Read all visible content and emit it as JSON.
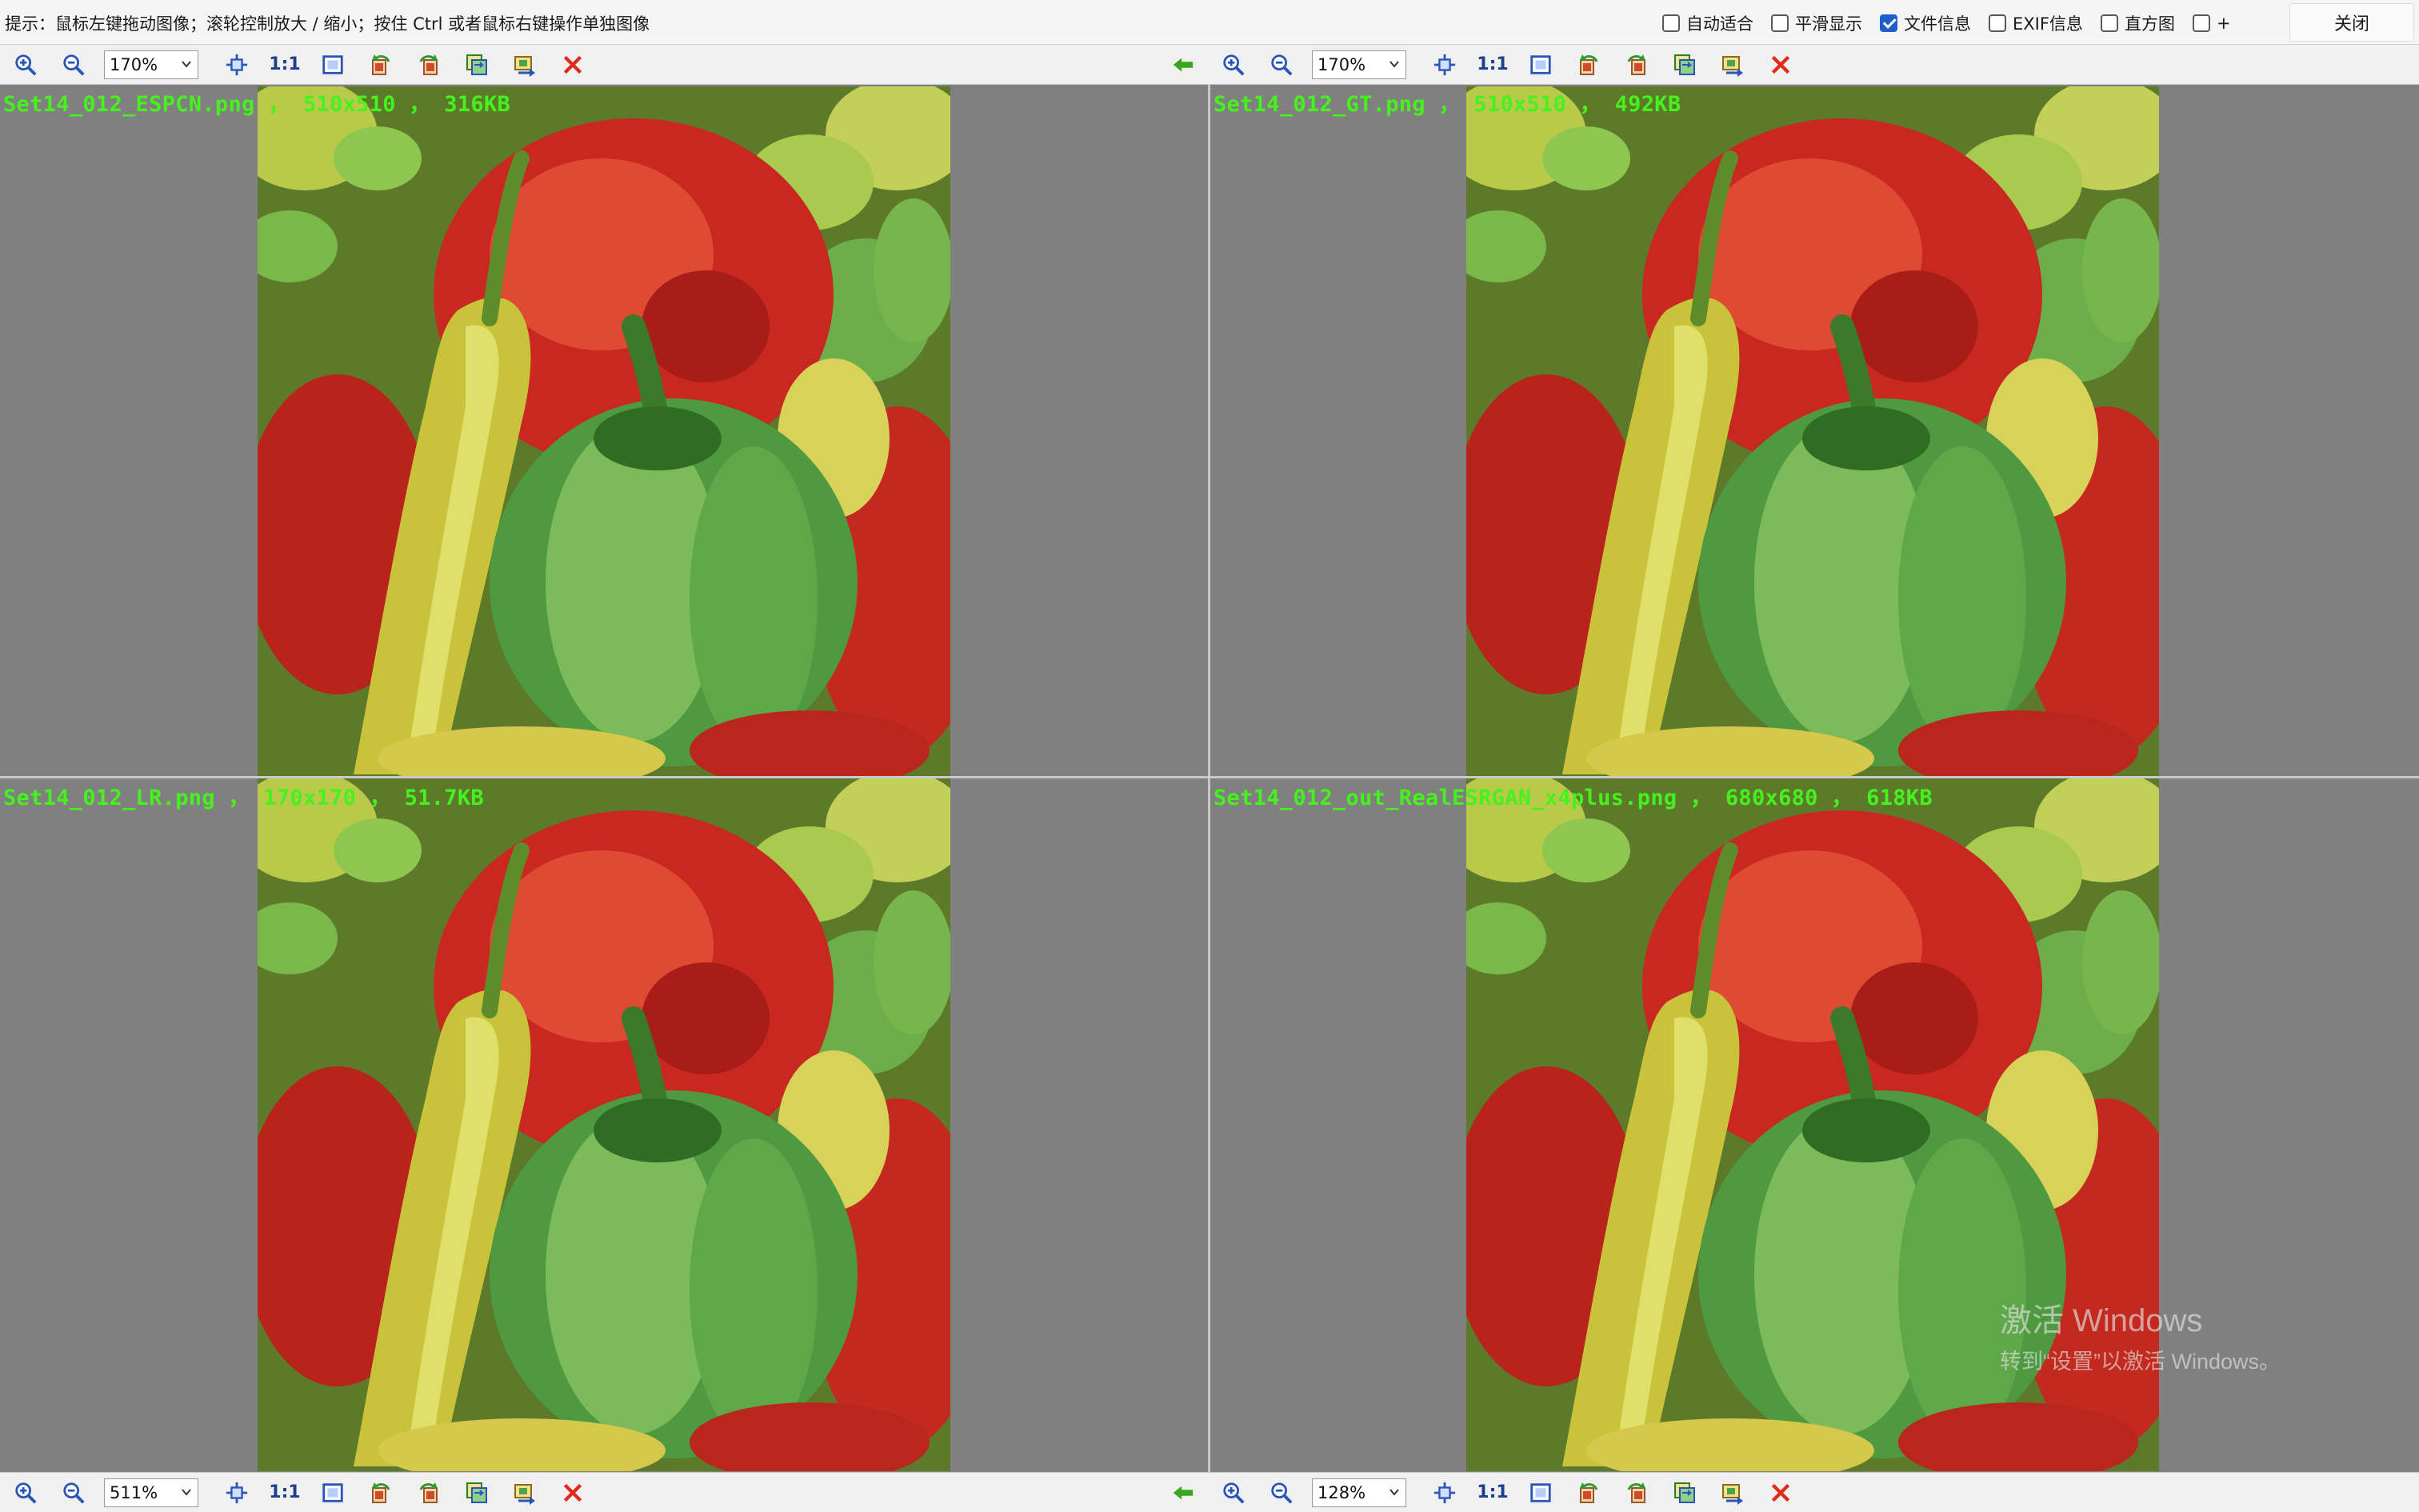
{
  "hint_text": "提示：鼠标左键拖动图像；滚轮控制放大 / 缩小；按住 Ctrl 或者鼠标右键操作单独图像",
  "options": [
    {
      "label": "自动适合",
      "checked": false
    },
    {
      "label": "平滑显示",
      "checked": false
    },
    {
      "label": "文件信息",
      "checked": true
    },
    {
      "label": "EXIF信息",
      "checked": false
    },
    {
      "label": "直方图",
      "checked": false
    },
    {
      "label": "+",
      "checked": false
    }
  ],
  "close_label": "关闭",
  "toolbars": {
    "top_left": {
      "zoom": "170%",
      "one_one": "1:1"
    },
    "top_right": {
      "zoom": "170%",
      "one_one": "1:1"
    },
    "bottom_left": {
      "zoom": "511%",
      "one_one": "1:1"
    },
    "bottom_right": {
      "zoom": "128%",
      "one_one": "1:1"
    }
  },
  "panes": {
    "top_left": {
      "label": "Set14_012_ESPCN.png ， 510x510 ， 316KB"
    },
    "top_right": {
      "label": "Set14_012_GT.png ， 510x510 ， 492KB"
    },
    "bottom_left": {
      "label": "Set14_012_LR.png ， 170x170 ， 51.7KB"
    },
    "bottom_right": {
      "label": "Set14_012_out_RealESRGAN_x4plus.png ， 680x680 ， 618KB"
    }
  },
  "colors": {
    "canvas_bg": "#808080",
    "label_green": "#46f21e",
    "checkbox_blue": "#1f5fc9",
    "close_x_red": "#e02a1a",
    "back_arrow_green": "#3aa51e"
  },
  "icons": [
    "zoom-in-icon",
    "zoom-out-icon",
    "fit-window-icon",
    "actual-size-button",
    "full-fit-icon",
    "rotate-left-icon",
    "rotate-right-icon",
    "flip-icon",
    "sync-icon",
    "close-image-icon",
    "back-arrow-icon"
  ],
  "watermark": {
    "line1": "激活 Windows",
    "line2": "转到“设置”以激活 Windows。"
  }
}
